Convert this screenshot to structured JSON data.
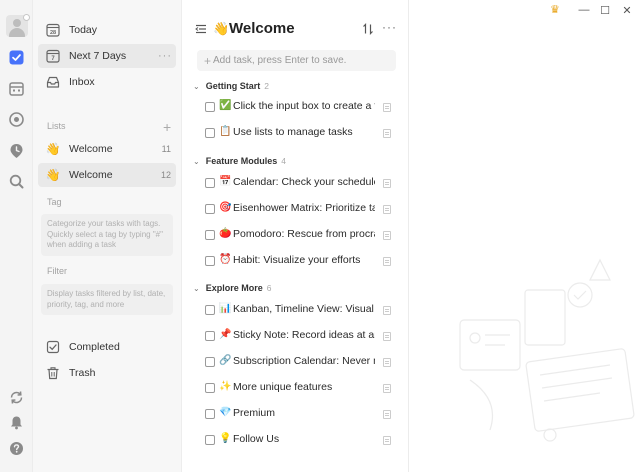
{
  "sidebar": {
    "smart": [
      {
        "label": "Today",
        "icon": "calendar-today-icon",
        "glyph": "28"
      },
      {
        "label": "Next 7 Days",
        "icon": "calendar-week-icon",
        "glyph": "7",
        "more": "···"
      },
      {
        "label": "Inbox",
        "icon": "inbox-icon"
      }
    ],
    "lists_title": "Lists",
    "lists_add": "+",
    "lists": [
      {
        "emoji": "👋",
        "label": "Welcome",
        "count": "11"
      },
      {
        "emoji": "👋",
        "label": "Welcome",
        "count": "12"
      }
    ],
    "tag_title": "Tag",
    "tag_hint": "Categorize your tasks with tags. Quickly select a tag by typing \"#\" when adding a task",
    "filter_title": "Filter",
    "filter_hint": "Display tasks filtered by list, date, priority, tag, and more",
    "bottom": [
      {
        "label": "Completed",
        "icon": "completed-icon"
      },
      {
        "label": "Trash",
        "icon": "trash-icon"
      }
    ]
  },
  "task_list": {
    "title_emoji": "👋",
    "title": "Welcome",
    "more": "···",
    "add_placeholder": "Add task, press Enter to save.",
    "add_plus": "+",
    "groups": [
      {
        "name": "Getting Start",
        "count": "2",
        "tasks": [
          {
            "emoji": "✅",
            "text": "Click the input box to create a task"
          },
          {
            "emoji": "📋",
            "text": "Use lists to manage tasks"
          }
        ]
      },
      {
        "name": "Feature Modules",
        "count": "4",
        "tasks": [
          {
            "emoji": "📅",
            "text": "Calendar: Check your schedule"
          },
          {
            "emoji": "🎯",
            "text": "Eisenhower Matrix: Prioritize tasks"
          },
          {
            "emoji": "🍅",
            "text": "Pomodoro: Rescue from procrastination"
          },
          {
            "emoji": "⏰",
            "text": "Habit: Visualize your efforts"
          }
        ]
      },
      {
        "name": "Explore More",
        "count": "6",
        "tasks": [
          {
            "emoji": "📊",
            "text": "Kanban, Timeline View: Visual management"
          },
          {
            "emoji": "📌",
            "text": "Sticky Note: Record ideas at any time"
          },
          {
            "emoji": "🔗",
            "text": "Subscription Calendar: Never miss events"
          },
          {
            "emoji": "✨",
            "text": "More unique features"
          },
          {
            "emoji": "💎",
            "text": "Premium"
          },
          {
            "emoji": "💡",
            "text": "Follow Us"
          }
        ]
      }
    ]
  },
  "window": {
    "minimize": "—",
    "maximize": "☐",
    "close": "✕",
    "crown": "♛"
  },
  "colors": {
    "accent": "#4772fa",
    "sidebar_bg": "#f7f7f7",
    "rail_bg": "#f4f4f4",
    "selected": "#e9e9e9"
  }
}
